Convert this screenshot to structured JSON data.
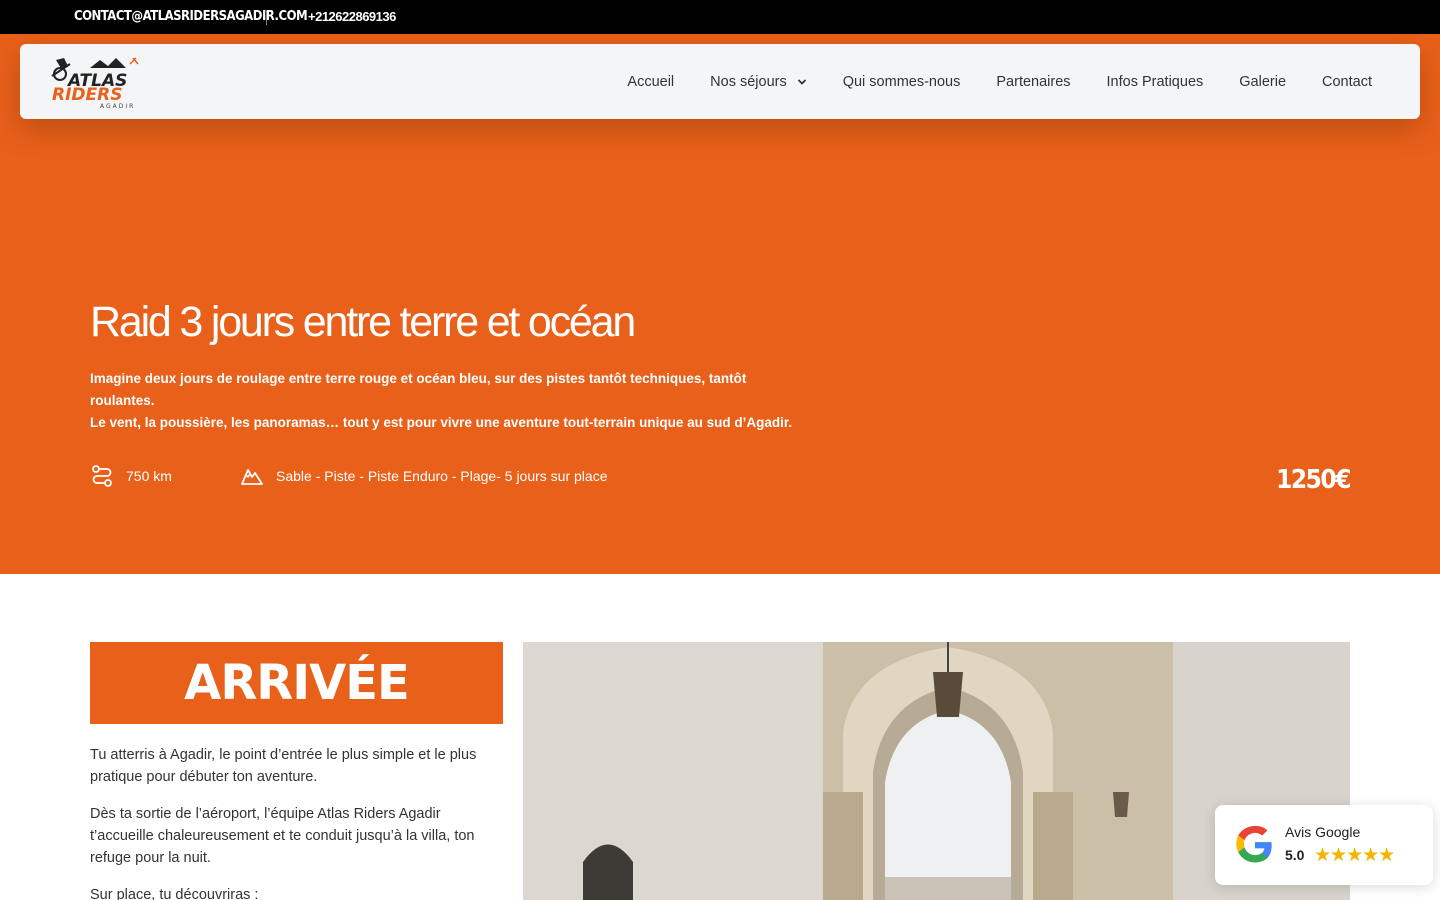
{
  "topbar": {
    "email": "CONTACT@ATLASRIDERSAGADIR.COM",
    "phone": "+212622869136"
  },
  "brand": {
    "logo_line1": "ATLAS",
    "logo_line2": "RIDERS",
    "logo_line3": "AGADIR",
    "accent": "#e8601a"
  },
  "nav": {
    "items": [
      {
        "label": "Accueil"
      },
      {
        "label": "Nos séjours"
      },
      {
        "label": "Qui sommes-nous"
      },
      {
        "label": "Partenaires"
      },
      {
        "label": "Infos Pratiques"
      },
      {
        "label": "Galerie"
      },
      {
        "label": "Contact"
      }
    ]
  },
  "hero": {
    "title": "Raid 3 jours entre terre et océan",
    "desc_line1": "Imagine deux jours de roulage entre terre rouge et océan bleu, sur des pistes tantôt techniques, tantôt roulantes.",
    "desc_line2": "Le vent, la poussière, les panoramas… tout y est pour vivre une aventure tout-terrain unique au sud d’Agadir.",
    "distance": "750 km",
    "terrain": "Sable - Piste - Piste Enduro - Plage- 5 jours sur place",
    "price": "1250€"
  },
  "arrival": {
    "heading": "ARRIVÉE",
    "p1": "Tu atterris à Agadir, le point d’entrée le plus simple et le plus pratique pour débuter ton aventure.",
    "p2": "Dès ta sortie de l’aéroport, l’équipe Atlas Riders Agadir t’accueille chaleureusement et te conduit jusqu’à la villa, ton refuge pour la nuit.",
    "p3": "Sur place, tu découvriras :"
  },
  "review": {
    "title": "Avis Google",
    "score": "5.0",
    "stars": "★★★★★",
    "rating": 5
  }
}
